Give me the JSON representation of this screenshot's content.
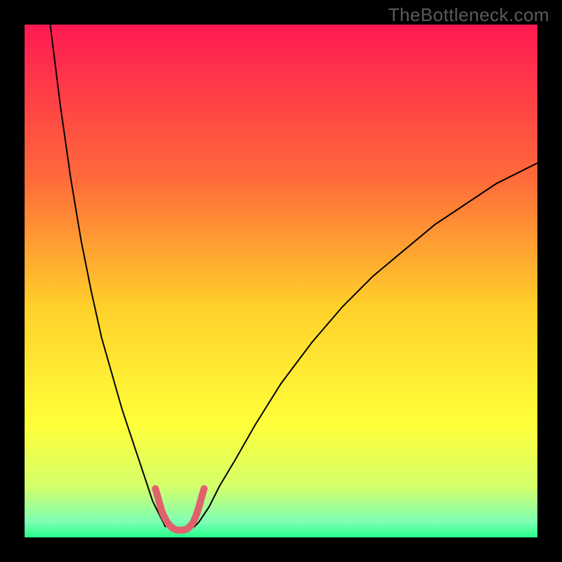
{
  "watermark": "TheBottleneck.com",
  "chart_data": {
    "type": "line",
    "title": "",
    "xlabel": "",
    "ylabel": "",
    "xlim": [
      0,
      100
    ],
    "ylim": [
      0,
      100
    ],
    "grid": false,
    "legend": false,
    "background_gradient": {
      "stops": [
        {
          "offset": 0.0,
          "color": "#ff1a52"
        },
        {
          "offset": 0.3,
          "color": "#ff6a3a"
        },
        {
          "offset": 0.55,
          "color": "#ffd02a"
        },
        {
          "offset": 0.78,
          "color": "#ffff3a"
        },
        {
          "offset": 0.9,
          "color": "#d4ff6a"
        },
        {
          "offset": 0.97,
          "color": "#7dffb4"
        },
        {
          "offset": 1.0,
          "color": "#25ff88"
        }
      ]
    },
    "series": [
      {
        "name": "left-curve",
        "color": "#000000",
        "width": 2,
        "x": [
          5,
          7,
          9,
          11,
          13,
          15,
          17,
          19,
          21,
          23,
          24,
          25,
          26,
          27,
          27.5
        ],
        "y": [
          100,
          84,
          70,
          58,
          48,
          39,
          32,
          25,
          19,
          13,
          10,
          7,
          5,
          3,
          2
        ]
      },
      {
        "name": "right-curve",
        "color": "#000000",
        "width": 2,
        "x": [
          33,
          34,
          36,
          38,
          41,
          45,
          50,
          56,
          62,
          68,
          74,
          80,
          86,
          92,
          98,
          100
        ],
        "y": [
          2,
          3,
          6,
          10,
          15,
          22,
          30,
          38,
          45,
          51,
          56,
          61,
          65,
          69,
          72,
          73
        ]
      },
      {
        "name": "trough-highlight",
        "color": "#e0616b",
        "width": 10,
        "linecap": "round",
        "x": [
          25.5,
          26,
          26.4,
          26.8,
          27.3,
          27.8,
          28.3,
          28.9,
          29.5,
          30.1,
          30.7,
          31.3,
          31.9,
          32.4,
          32.9,
          33.3,
          33.7,
          34.1,
          34.5,
          35.0
        ],
        "y": [
          9.5,
          7.8,
          6.3,
          5.0,
          3.9,
          3.0,
          2.3,
          1.8,
          1.5,
          1.4,
          1.4,
          1.5,
          1.8,
          2.3,
          3.0,
          3.9,
          5.0,
          6.3,
          7.8,
          9.5
        ]
      }
    ]
  }
}
